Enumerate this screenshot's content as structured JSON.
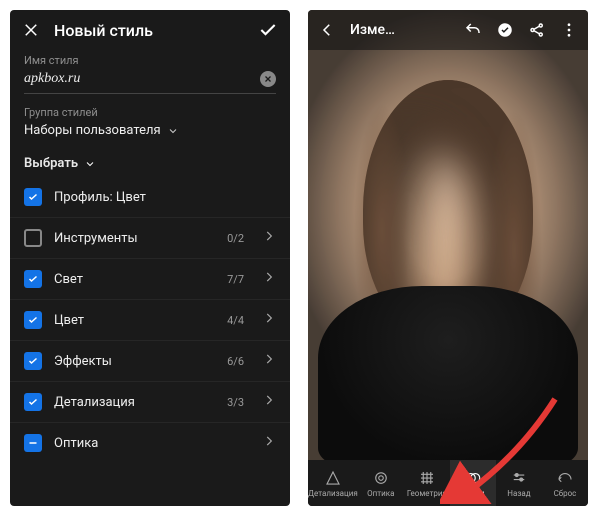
{
  "left": {
    "title": "Новый стиль",
    "name_label": "Имя стиля",
    "name_value": "apkbox.ru",
    "group_label": "Группа стилей",
    "group_value": "Наборы пользователя",
    "select_label": "Выбрать",
    "options": [
      {
        "name": "Профиль: Цвет",
        "count": "",
        "state": "checked"
      },
      {
        "name": "Инструменты",
        "count": "0/2",
        "state": "unchecked"
      },
      {
        "name": "Свет",
        "count": "7/7",
        "state": "checked"
      },
      {
        "name": "Цвет",
        "count": "4/4",
        "state": "checked"
      },
      {
        "name": "Эффекты",
        "count": "6/6",
        "state": "checked"
      },
      {
        "name": "Детализация",
        "count": "3/3",
        "state": "checked"
      },
      {
        "name": "Оптика",
        "count": "",
        "state": "partial"
      }
    ]
  },
  "right": {
    "title": "Изме…",
    "tools": [
      {
        "label": "Детализация"
      },
      {
        "label": "Оптика"
      },
      {
        "label": "Геометрия"
      },
      {
        "label": "Стили"
      },
      {
        "label": "Назад"
      },
      {
        "label": "Сброс"
      }
    ]
  }
}
